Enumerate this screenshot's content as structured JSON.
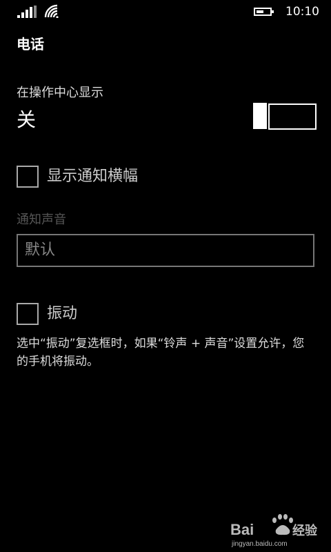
{
  "status_bar": {
    "time": "10:10",
    "battery_level": 0.55
  },
  "page": {
    "title": "电话"
  },
  "action_center": {
    "header": "在操作中心显示",
    "state_label": "关",
    "enabled": false
  },
  "banner": {
    "label": "显示通知横幅",
    "checked": false
  },
  "sound": {
    "header": "通知声音",
    "value": "默认"
  },
  "vibrate": {
    "label": "振动",
    "checked": false,
    "description": "选中“振动”复选框时，如果“铃声 + 声音”设置允许，您的手机将振动。"
  },
  "watermark": {
    "brand": "Bai",
    "suffix": "经验",
    "url": "jingyan.baidu.com"
  },
  "colors": {
    "background": "#000000",
    "foreground": "#ffffff"
  }
}
